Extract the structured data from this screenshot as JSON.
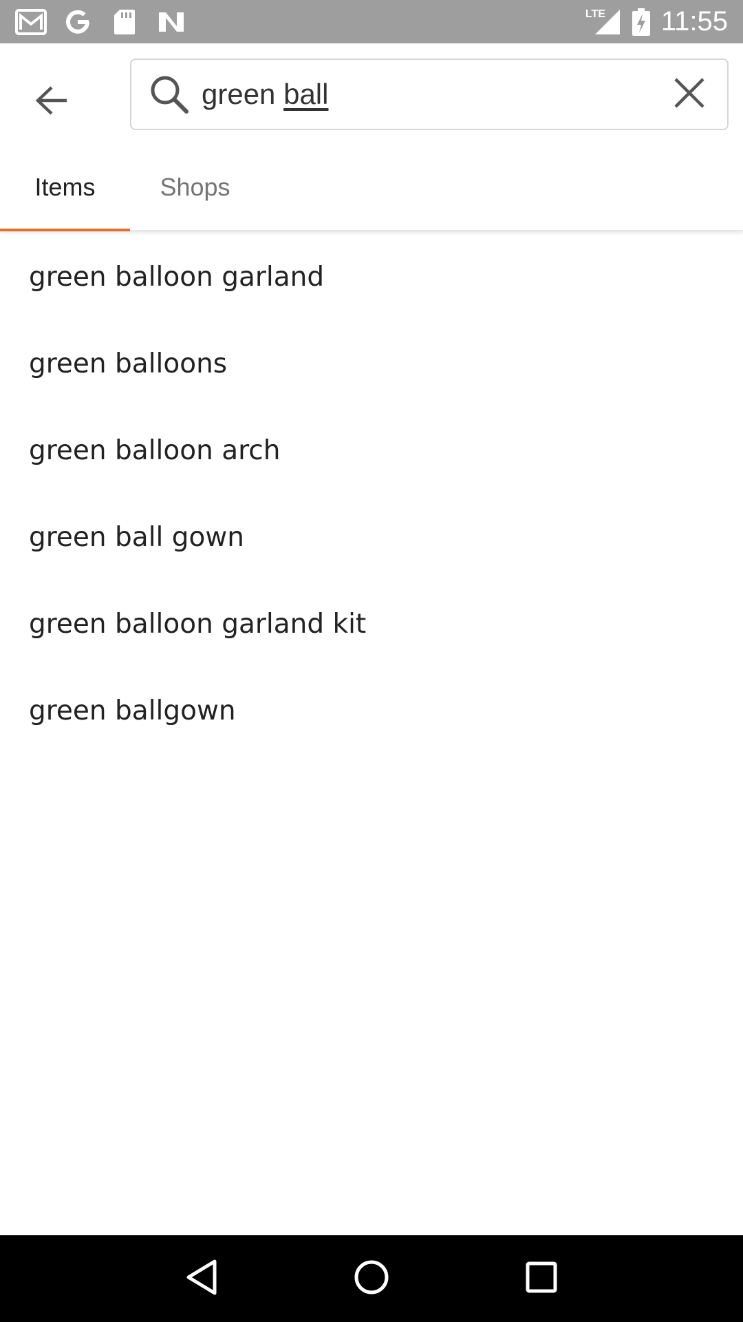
{
  "status_bar": {
    "time": "11:55",
    "network_label": "LTE",
    "icons": [
      "gmail-icon",
      "google-icon",
      "sd-card-icon",
      "n-app-icon",
      "signal-icon",
      "battery-charging-icon"
    ]
  },
  "search": {
    "query_prefix": "green ",
    "query_underlined": "ball",
    "back_icon": "arrow-left-icon",
    "search_icon": "search-icon",
    "clear_icon": "close-icon"
  },
  "tabs": [
    {
      "label": "Items",
      "active": true
    },
    {
      "label": "Shops",
      "active": false
    }
  ],
  "suggestions": [
    "green balloon garland",
    "green balloons",
    "green balloon arch",
    "green ball gown",
    "green balloon garland kit",
    "green ballgown"
  ],
  "nav_bar": {
    "icons": [
      "back-triangle-icon",
      "home-circle-icon",
      "recents-square-icon"
    ]
  },
  "colors": {
    "accent": "#e36f2c",
    "status_bar": "#9e9e9e",
    "nav_bar": "#000000"
  }
}
